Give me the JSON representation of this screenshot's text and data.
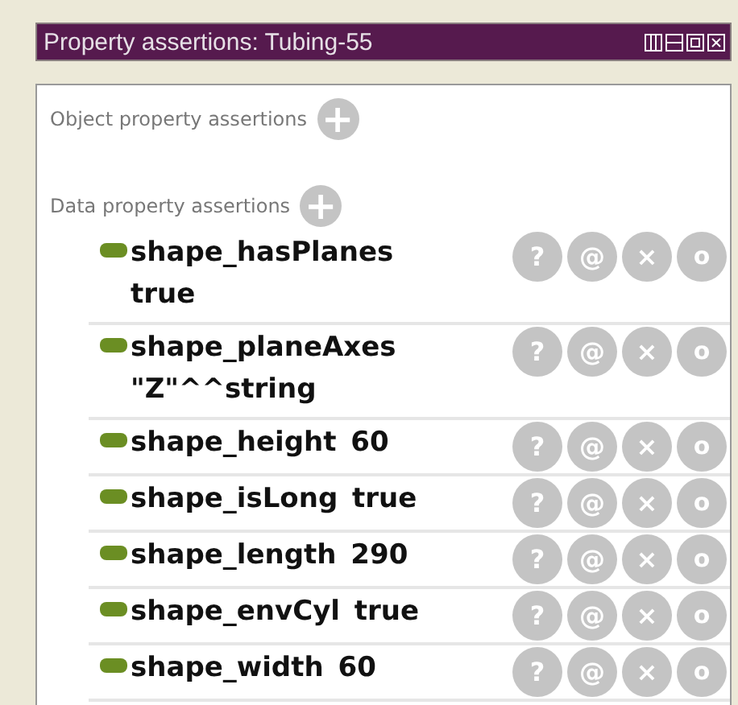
{
  "panel": {
    "title": "Property assertions: Tubing-55"
  },
  "sections": [
    {
      "label": "Object property assertions",
      "add": "+"
    },
    {
      "label": "Data property assertions",
      "add": "+"
    }
  ],
  "assertions": [
    {
      "text": "shape_hasPlanes true",
      "buttons": [
        {
          "kind": "explain",
          "glyph": "?"
        },
        {
          "kind": "annotate",
          "glyph": "@"
        },
        {
          "kind": "delete",
          "glyph": "×"
        },
        {
          "kind": "edit",
          "glyph": "o"
        }
      ]
    },
    {
      "text": "shape_planeAxes \"Z\"^^string",
      "buttons": [
        {
          "kind": "explain",
          "glyph": "?"
        },
        {
          "kind": "annotate",
          "glyph": "@"
        },
        {
          "kind": "delete",
          "glyph": "×"
        },
        {
          "kind": "edit",
          "glyph": "o"
        }
      ]
    },
    {
      "text": "shape_height 60",
      "buttons": [
        {
          "kind": "explain",
          "glyph": "?"
        },
        {
          "kind": "annotate",
          "glyph": "@"
        },
        {
          "kind": "delete",
          "glyph": "×"
        },
        {
          "kind": "edit",
          "glyph": "o"
        }
      ]
    },
    {
      "text": "shape_isLong true",
      "buttons": [
        {
          "kind": "explain",
          "glyph": "?"
        },
        {
          "kind": "annotate",
          "glyph": "@"
        },
        {
          "kind": "delete",
          "glyph": "×"
        },
        {
          "kind": "edit",
          "glyph": "o"
        }
      ]
    },
    {
      "text": "shape_length 290",
      "buttons": [
        {
          "kind": "explain",
          "glyph": "?"
        },
        {
          "kind": "annotate",
          "glyph": "@"
        },
        {
          "kind": "delete",
          "glyph": "×"
        },
        {
          "kind": "edit",
          "glyph": "o"
        }
      ]
    },
    {
      "text": "shape_envCyl true",
      "buttons": [
        {
          "kind": "explain",
          "glyph": "?"
        },
        {
          "kind": "annotate",
          "glyph": "@"
        },
        {
          "kind": "delete",
          "glyph": "×"
        },
        {
          "kind": "edit",
          "glyph": "o"
        }
      ]
    },
    {
      "text": "shape_width 60",
      "buttons": [
        {
          "kind": "explain",
          "glyph": "?"
        },
        {
          "kind": "annotate",
          "glyph": "@"
        },
        {
          "kind": "delete",
          "glyph": "×"
        },
        {
          "kind": "edit",
          "glyph": "o"
        }
      ]
    }
  ]
}
